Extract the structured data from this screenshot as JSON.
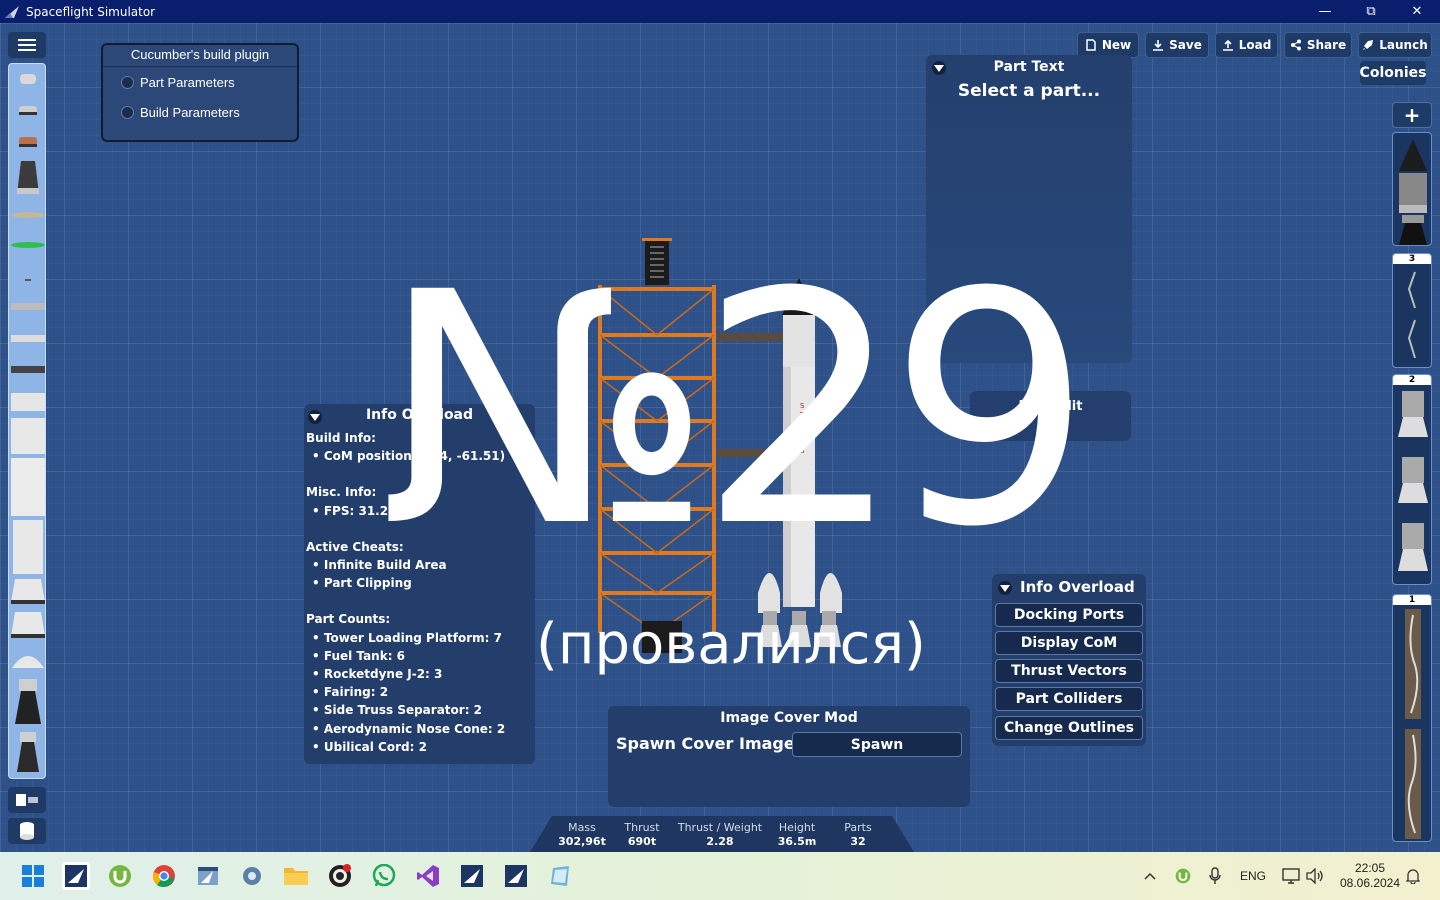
{
  "window": {
    "title": "Spaceflight Simulator"
  },
  "plugin": {
    "title": "Cucumber's build plugin",
    "items": [
      "Part Parameters",
      "Build Parameters"
    ]
  },
  "toolbar": {
    "new": "New",
    "save": "Save",
    "load": "Load",
    "share": "Share",
    "launch": "Launch",
    "colonies": "Colonies"
  },
  "stages": [
    "3",
    "2",
    "1"
  ],
  "part_text": {
    "title": "Part Text",
    "prompt": "Select a part..."
  },
  "part_editor": {
    "title": "Part Edit"
  },
  "info_left": {
    "title": "Info Overload",
    "build_info_header": "Build Info:",
    "com_position": "CoM position: (-54, -61.51)",
    "misc_header": "Misc. Info:",
    "fps": "FPS: 31.21",
    "cheats_header": "Active Cheats:",
    "cheats": [
      "Infinite Build Area",
      "Part Clipping"
    ],
    "counts_header": "Part Counts:",
    "counts": [
      "Tower Loading Platform: 7",
      "Fuel Tank: 6",
      "Rocketdyne J-2: 3",
      "Fairing: 2",
      "Side Truss Separator: 2",
      "Aerodynamic Nose Cone: 2",
      "Ubilical Cord: 2"
    ]
  },
  "cover_mod": {
    "title": "Image Cover Mod",
    "label": "Spawn Cover Image",
    "button": "Spawn"
  },
  "info_right": {
    "title": "Info Overload",
    "buttons": [
      "Docking Ports",
      "Display CoM",
      "Thrust Vectors",
      "Part Colliders",
      "Change Outlines"
    ]
  },
  "stats": {
    "mass_label": "Mass",
    "mass": "302,96t",
    "thrust_label": "Thrust",
    "thrust": "690t",
    "tw_label": "Thrust / Weight",
    "tw": "2.28",
    "height_label": "Height",
    "height": "36.5m",
    "parts_label": "Parts",
    "parts": "32"
  },
  "overlay": {
    "title": "№29",
    "subtitle": "(провалился)"
  },
  "rocket": {
    "stripe_text": "STATES"
  },
  "taskbar": {
    "lang": "ENG",
    "time": "22:05",
    "date": "08.06.2024"
  },
  "colors": {
    "background": "#2e5189",
    "panel": "#243e6b",
    "titlebar": "#0a1e6e",
    "tower": "#e07a1f"
  }
}
